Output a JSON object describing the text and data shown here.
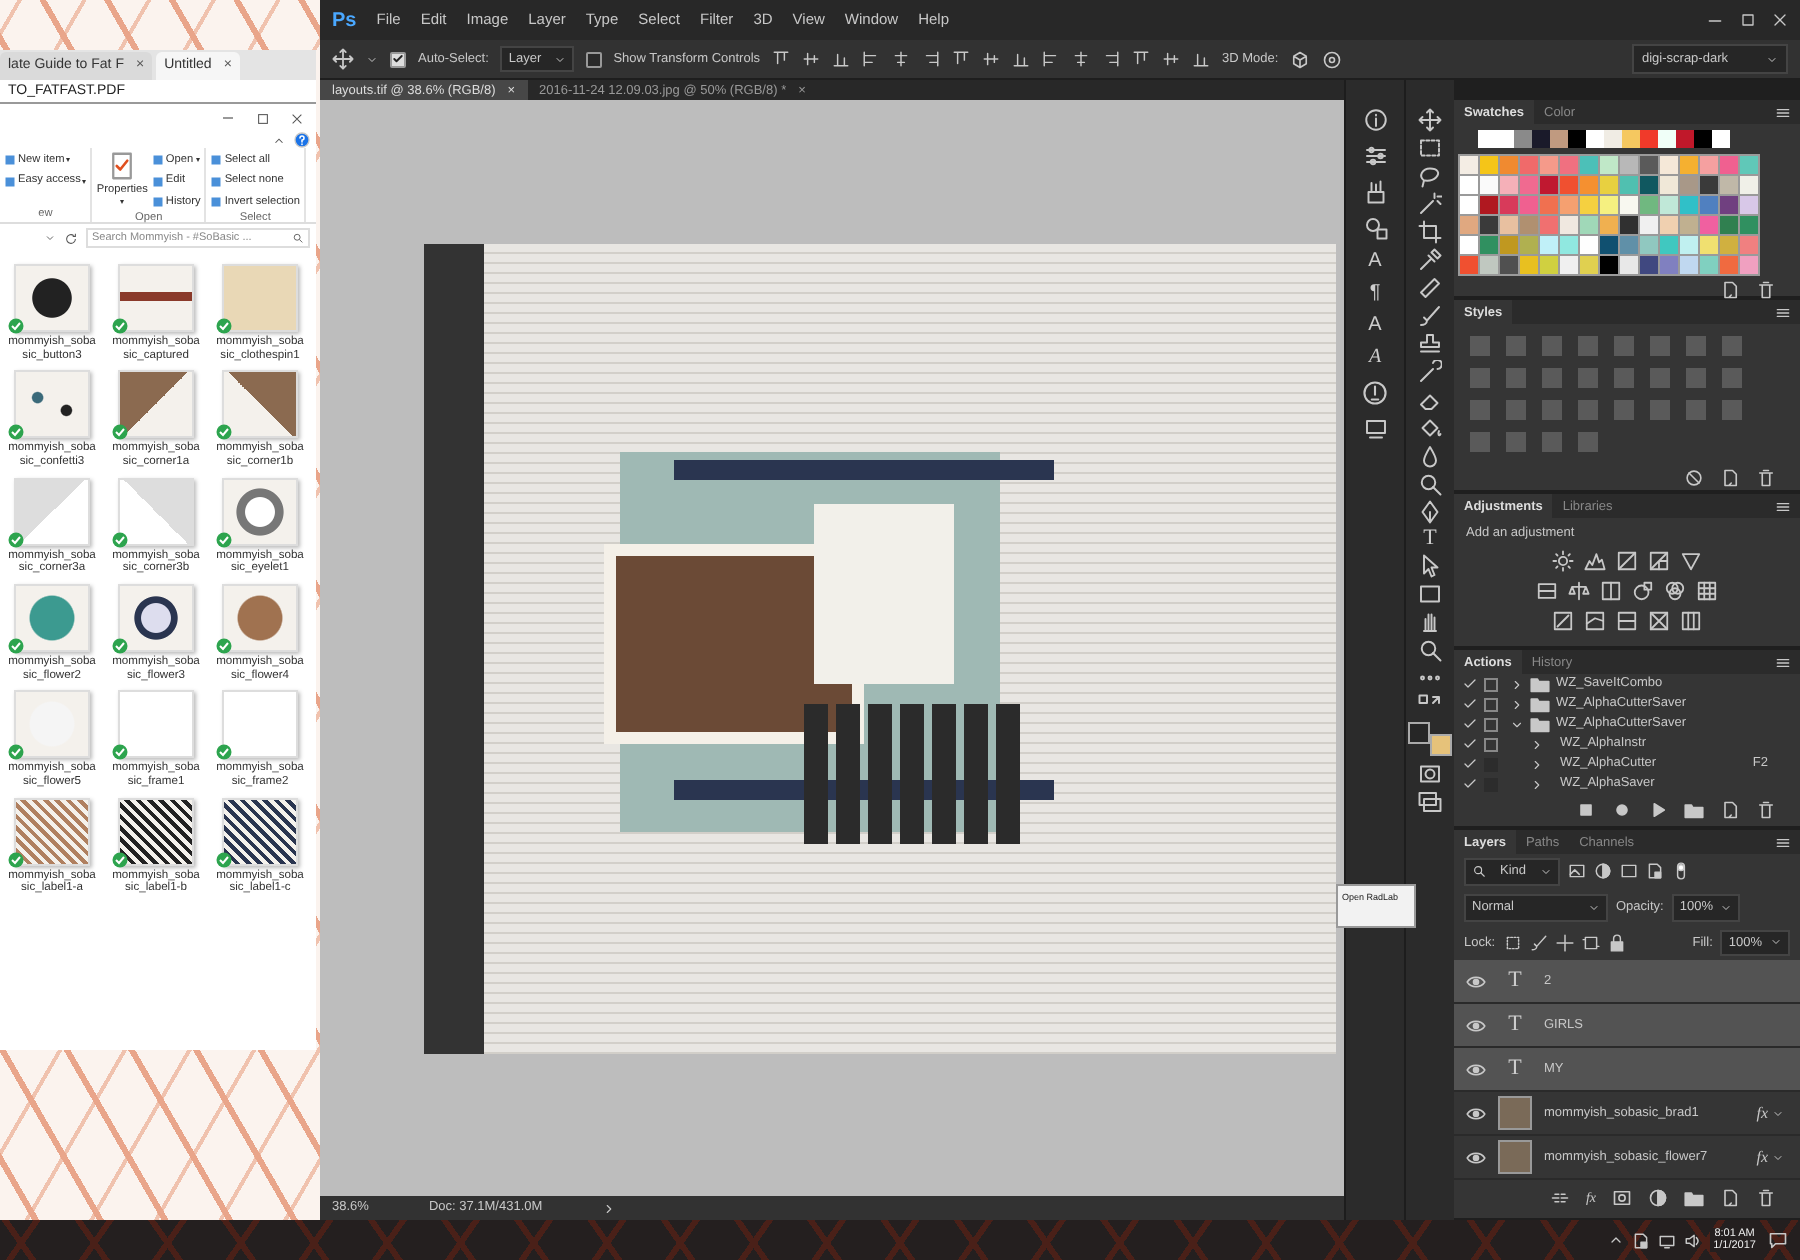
{
  "browser": {
    "tabs": [
      {
        "label": "late Guide to Fat F",
        "close": "×",
        "selected": false
      },
      {
        "label": "Untitled",
        "close": "×",
        "selected": true
      }
    ],
    "document_title": "TO_FATFAST.PDF"
  },
  "explorer": {
    "ribbon": [
      {
        "label": "ew",
        "items": [
          {
            "label": "New item",
            "dropdown": true
          },
          {
            "label": "Easy access",
            "dropdown": true
          }
        ]
      },
      {
        "label": "Open",
        "items": [
          {
            "label": "Properties",
            "dropdown": true,
            "kind": "large"
          },
          {
            "label": "Open",
            "dropdown": true
          },
          {
            "label": "Edit",
            "dropdown": false
          },
          {
            "label": "History",
            "dropdown": false
          }
        ]
      },
      {
        "label": "Select",
        "items": [
          {
            "label": "Select all"
          },
          {
            "label": "Select none"
          },
          {
            "label": "Invert selection"
          }
        ]
      }
    ],
    "search": {
      "placeholder": "Search Mommyish - #SoBasic ..."
    },
    "files": [
      {
        "name": "mommyish_sobasic_button3",
        "synced": true
      },
      {
        "name": "mommyish_sobasic_captured",
        "synced": true
      },
      {
        "name": "mommyish_sobasic_clothespin1",
        "synced": true
      },
      {
        "name": "mommyish_sobasic_confetti3",
        "synced": true
      },
      {
        "name": "mommyish_sobasic_corner1a",
        "synced": true
      },
      {
        "name": "mommyish_sobasic_corner1b",
        "synced": true
      },
      {
        "name": "mommyish_sobasic_corner3a",
        "synced": true
      },
      {
        "name": "mommyish_sobasic_corner3b",
        "synced": true
      },
      {
        "name": "mommyish_sobasic_eyelet1",
        "synced": true
      },
      {
        "name": "mommyish_sobasic_flower2",
        "synced": true
      },
      {
        "name": "mommyish_sobasic_flower3",
        "synced": true
      },
      {
        "name": "mommyish_sobasic_flower4",
        "synced": true
      },
      {
        "name": "mommyish_sobasic_flower5",
        "synced": true
      },
      {
        "name": "mommyish_sobasic_frame1",
        "synced": true
      },
      {
        "name": "mommyish_sobasic_frame2",
        "synced": true
      },
      {
        "name": "mommyish_sobasic_label1-a",
        "synced": true
      },
      {
        "name": "mommyish_sobasic_label1-b",
        "synced": true
      },
      {
        "name": "mommyish_sobasic_label1-c",
        "synced": true
      }
    ]
  },
  "photoshop": {
    "logo": "Ps",
    "menu": [
      "File",
      "Edit",
      "Image",
      "Layer",
      "Type",
      "Select",
      "Filter",
      "3D",
      "View",
      "Window",
      "Help"
    ],
    "options": {
      "auto_select": {
        "label": "Auto-Select:",
        "checked": true
      },
      "target": "Layer",
      "show_transform": {
        "label": "Show Transform Controls",
        "checked": false
      },
      "mode_label": "3D Mode:",
      "workspace": "digi-scrap-dark"
    },
    "documents": [
      {
        "label": "layouts.tif @ 38.6% (RGB/8)",
        "close": "×",
        "selected": true
      },
      {
        "label": "2016-11-24 12.09.03.jpg @ 50% (RGB/8) *",
        "close": "×",
        "selected": false
      }
    ],
    "status_bar": {
      "zoom": "38.6%",
      "doc": "Doc: 37.1M/431.0M"
    },
    "popup": {
      "label": "Open RadLab"
    },
    "dock_glyphs": [
      "A",
      "¶",
      "A",
      "A"
    ],
    "type_tool": "T",
    "color_chips": [
      {
        "color": "#262626"
      },
      {
        "color": "#e6c27a"
      }
    ],
    "swatches": {
      "tabs": [
        {
          "label": "Swatches",
          "selected": true
        },
        {
          "label": "Color",
          "selected": false
        }
      ],
      "recent": [
        {
          "color": "#ffffff"
        },
        {
          "color": "#ffffff"
        },
        {
          "color": "#8a8a8a"
        },
        {
          "color": "#1a1a2a"
        },
        {
          "color": "#c09a80"
        },
        {
          "color": "#000000"
        },
        {
          "color": "#ffffff"
        },
        {
          "color": "#f0ece4"
        },
        {
          "color": "#f5c860"
        },
        {
          "color": "#f03a2a"
        },
        {
          "color": "#f0fff8"
        },
        {
          "color": "#c0182a"
        },
        {
          "color": "#000000"
        },
        {
          "color": "#ffffff"
        }
      ],
      "grid": [
        [
          {
            "color": "#f4ede4"
          },
          {
            "color": "#f5c518"
          },
          {
            "color": "#f08a30"
          },
          {
            "color": "#f06a6a"
          },
          {
            "color": "#f59a8a"
          },
          {
            "color": "#f07080"
          },
          {
            "color": "#4cc0b8"
          },
          {
            "color": "#c0e8c8"
          },
          {
            "color": "#b8b8b8"
          },
          {
            "color": "#5a5a5a"
          },
          {
            "color": "#f5e8d8"
          },
          {
            "color": "#f5b030"
          },
          {
            "color": "#f5a0a0"
          },
          {
            "color": "#f06090"
          },
          {
            "color": "#60c8b8"
          }
        ],
        [
          {
            "color": "#ffffff"
          },
          {
            "color": "#fafafa"
          },
          {
            "color": "#f5b0b8"
          },
          {
            "color": "#f06a90"
          },
          {
            "color": "#c01830"
          },
          {
            "color": "#f05030"
          },
          {
            "color": "#f59030"
          },
          {
            "color": "#e8d040"
          },
          {
            "color": "#50c0b0"
          },
          {
            "color": "#105860"
          },
          {
            "color": "#f0e8d8"
          },
          {
            "color": "#a89888"
          },
          {
            "color": "#3a3a3a"
          },
          {
            "color": "#c0b8a8"
          },
          {
            "color": "#f0f0e8"
          }
        ],
        [
          {
            "color": "#ffffff"
          },
          {
            "color": "#b01820"
          },
          {
            "color": "#d83a5a"
          },
          {
            "color": "#f06090"
          },
          {
            "color": "#f07050"
          },
          {
            "color": "#f5a070"
          },
          {
            "color": "#f5d040"
          },
          {
            "color": "#f5f080"
          },
          {
            "color": "#f8f8f0"
          },
          {
            "color": "#70b880"
          },
          {
            "color": "#c0e8d8"
          },
          {
            "color": "#30c0c8"
          },
          {
            "color": "#5080c0"
          },
          {
            "color": "#704080"
          },
          {
            "color": "#d8c8e8"
          }
        ],
        [
          {
            "color": "#e0a880"
          },
          {
            "color": "#3a3a3a"
          },
          {
            "color": "#e8c0a0"
          },
          {
            "color": "#b09070"
          },
          {
            "color": "#f07070"
          },
          {
            "color": "#f0e8e0"
          },
          {
            "color": "#a0d8b8"
          },
          {
            "color": "#f0b050"
          },
          {
            "color": "#303030"
          },
          {
            "color": "#f0f0f0"
          },
          {
            "color": "#f0d0b0"
          },
          {
            "color": "#c0b090"
          },
          {
            "color": "#f060a0"
          },
          {
            "color": "#308050"
          },
          {
            "color": "#309060"
          }
        ],
        [
          {
            "color": "#ffffff"
          },
          {
            "color": "#309060"
          },
          {
            "color": "#c09820"
          },
          {
            "color": "#b0b050"
          },
          {
            "color": "#c0f0f8"
          },
          {
            "color": "#90e8e0"
          },
          {
            "color": "#fefefe"
          },
          {
            "color": "#105070"
          },
          {
            "color": "#6090a8"
          },
          {
            "color": "#90c8c0"
          },
          {
            "color": "#40c8c0"
          },
          {
            "color": "#c0f0f0"
          },
          {
            "color": "#f0e070"
          },
          {
            "color": "#d0b040"
          },
          {
            "color": "#f08080"
          }
        ],
        [
          {
            "color": "#f05030"
          },
          {
            "color": "#c0c8c0"
          },
          {
            "color": "#505050"
          },
          {
            "color": "#e8c020"
          },
          {
            "color": "#d0d040"
          },
          {
            "color": "#f0f0f0"
          },
          {
            "color": "#e0d050"
          },
          {
            "color": "#000000"
          },
          {
            "color": "#e8e8e8"
          },
          {
            "color": "#404880"
          },
          {
            "color": "#8080c0"
          },
          {
            "color": "#c0d8f0"
          },
          {
            "color": "#80d0c0"
          },
          {
            "color": "#f06a40"
          },
          {
            "color": "#f0a0c0"
          }
        ]
      ]
    },
    "styles": {
      "tabs": [
        {
          "label": "Styles",
          "selected": true
        }
      ]
    },
    "adjustments": {
      "tabs": [
        {
          "label": "Adjustments",
          "selected": true
        },
        {
          "label": "Libraries",
          "selected": false
        }
      ],
      "heading": "Add an adjustment"
    },
    "actions": {
      "tabs": [
        {
          "label": "Actions",
          "selected": true
        },
        {
          "label": "History",
          "selected": false
        }
      ],
      "items": [
        {
          "name": "WZ_SaveItCombo",
          "kind": "set",
          "checked": true,
          "dialog": true,
          "expanded": false
        },
        {
          "name": "WZ_AlphaCutterSaver",
          "kind": "set",
          "checked": true,
          "dialog": true,
          "expanded": false
        },
        {
          "name": "WZ_AlphaCutterSaver",
          "kind": "set",
          "checked": true,
          "dialog": true,
          "expanded": true,
          "children": [
            {
              "name": "WZ_AlphaInstr",
              "kind": "action",
              "checked": true,
              "dialog": true,
              "expanded": false
            },
            {
              "name": "WZ_AlphaCutter",
              "kind": "action",
              "checked": true,
              "dialog": false,
              "expanded": false,
              "shortcut": "F2"
            },
            {
              "name": "WZ_AlphaSaver",
              "kind": "action",
              "checked": true,
              "dialog": false,
              "expanded": false
            }
          ]
        }
      ]
    },
    "layers": {
      "tabs": [
        {
          "label": "Layers",
          "selected": true
        },
        {
          "label": "Paths",
          "selected": false
        },
        {
          "label": "Channels",
          "selected": false
        }
      ],
      "filter": "Kind",
      "blend_mode": "Normal",
      "opacity_label": "Opacity:",
      "opacity": "100%",
      "lock_label": "Lock:",
      "fill_label": "Fill:",
      "fill": "100%",
      "footer_fx": "fx",
      "items": [
        {
          "name": "2",
          "kind": "text",
          "thumb": "T",
          "visible": true,
          "selected": true
        },
        {
          "name": "GIRLS",
          "kind": "text",
          "thumb": "T",
          "visible": true,
          "selected": true
        },
        {
          "name": "MY",
          "kind": "text",
          "thumb": "T",
          "visible": true,
          "selected": true
        },
        {
          "name": "mommyish_sobasic_brad1",
          "kind": "image",
          "fx": "fx",
          "visible": true,
          "selected": false
        },
        {
          "name": "mommyish_sobasic_flower7",
          "kind": "image",
          "fx": "fx",
          "visible": true,
          "selected": false
        }
      ]
    }
  },
  "taskbar": {
    "time": "8:01 AM",
    "date": "1/1/2017"
  }
}
